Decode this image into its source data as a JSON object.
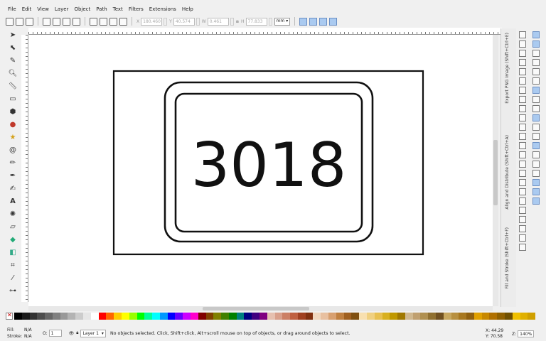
{
  "menu": [
    "File",
    "Edit",
    "View",
    "Layer",
    "Object",
    "Path",
    "Text",
    "Filters",
    "Extensions",
    "Help"
  ],
  "controls": {
    "x_label": "X",
    "x_value": "180.460",
    "y_label": "Y",
    "y_value": "40.574",
    "w_label": "W",
    "w_value": "0.461",
    "h_label": "H",
    "h_value": "77.833",
    "unit": "mm"
  },
  "canvas": {
    "plate_text": "3018"
  },
  "dock_tabs": [
    "Export PNG Image (Shift+Ctrl+E)",
    "Align and Distribute (Shift+Ctrl+A)",
    "Fill and Stroke (Shift+Ctrl+F)"
  ],
  "status": {
    "fill_label": "Fill:",
    "fill_value": "N/A",
    "stroke_label": "Stroke:",
    "stroke_value": "N/A",
    "opacity_label": "O:",
    "opacity_value": "1",
    "layer_value": "Layer 1",
    "message": "No objects selected. Click, Shift+click, Alt+scroll mouse on top of objects, or drag around objects to select.",
    "x_label": "X:",
    "x_value": "44.29",
    "y_label": "Y:",
    "y_value": "70.58",
    "zoom_label": "Z:",
    "zoom_value": "140%"
  },
  "palette_colors": [
    "#000000",
    "#1a1a1a",
    "#333333",
    "#4d4d4d",
    "#666666",
    "#808080",
    "#999999",
    "#b3b3b3",
    "#cccccc",
    "#e6e6e6",
    "#ffffff",
    "#ff0000",
    "#ff6600",
    "#ffcc00",
    "#ffff00",
    "#99ff00",
    "#00ff00",
    "#00ff99",
    "#00ffff",
    "#0099ff",
    "#0000ff",
    "#6600ff",
    "#cc00ff",
    "#ff00cc",
    "#800000",
    "#804000",
    "#808000",
    "#408000",
    "#008000",
    "#008080",
    "#000080",
    "#400080",
    "#800080",
    "#e6c0b0",
    "#d9a08c",
    "#cc8066",
    "#c06040",
    "#a04020",
    "#803010",
    "#f0d8c0",
    "#e8c0a0",
    "#d8a070",
    "#c08040",
    "#a06020",
    "#805010",
    "#f8e0b0",
    "#f0d080",
    "#e8c050",
    "#d8b020",
    "#c09800",
    "#a07800",
    "#d0b890",
    "#c0a070",
    "#b09050",
    "#907030",
    "#705020",
    "#c8a860",
    "#b89040",
    "#a87820",
    "#906010",
    "#e0a000",
    "#c88800",
    "#b07000",
    "#906000",
    "#705000",
    "#f0c000",
    "#e0b000",
    "#d0a000"
  ],
  "icons": {
    "tools": [
      "selector-icon",
      "node-icon",
      "tweak-icon",
      "zoom-icon",
      "measure-icon",
      "rect-icon",
      "3dbox-icon",
      "ellipse-icon",
      "star-icon",
      "spiral-icon",
      "pencil-icon",
      "pen-icon",
      "calligraphy-icon",
      "text-icon",
      "spray-icon",
      "eraser-icon",
      "bucket-icon",
      "gradient-icon",
      "mesh-icon",
      "dropper-icon",
      "connector-icon"
    ]
  }
}
